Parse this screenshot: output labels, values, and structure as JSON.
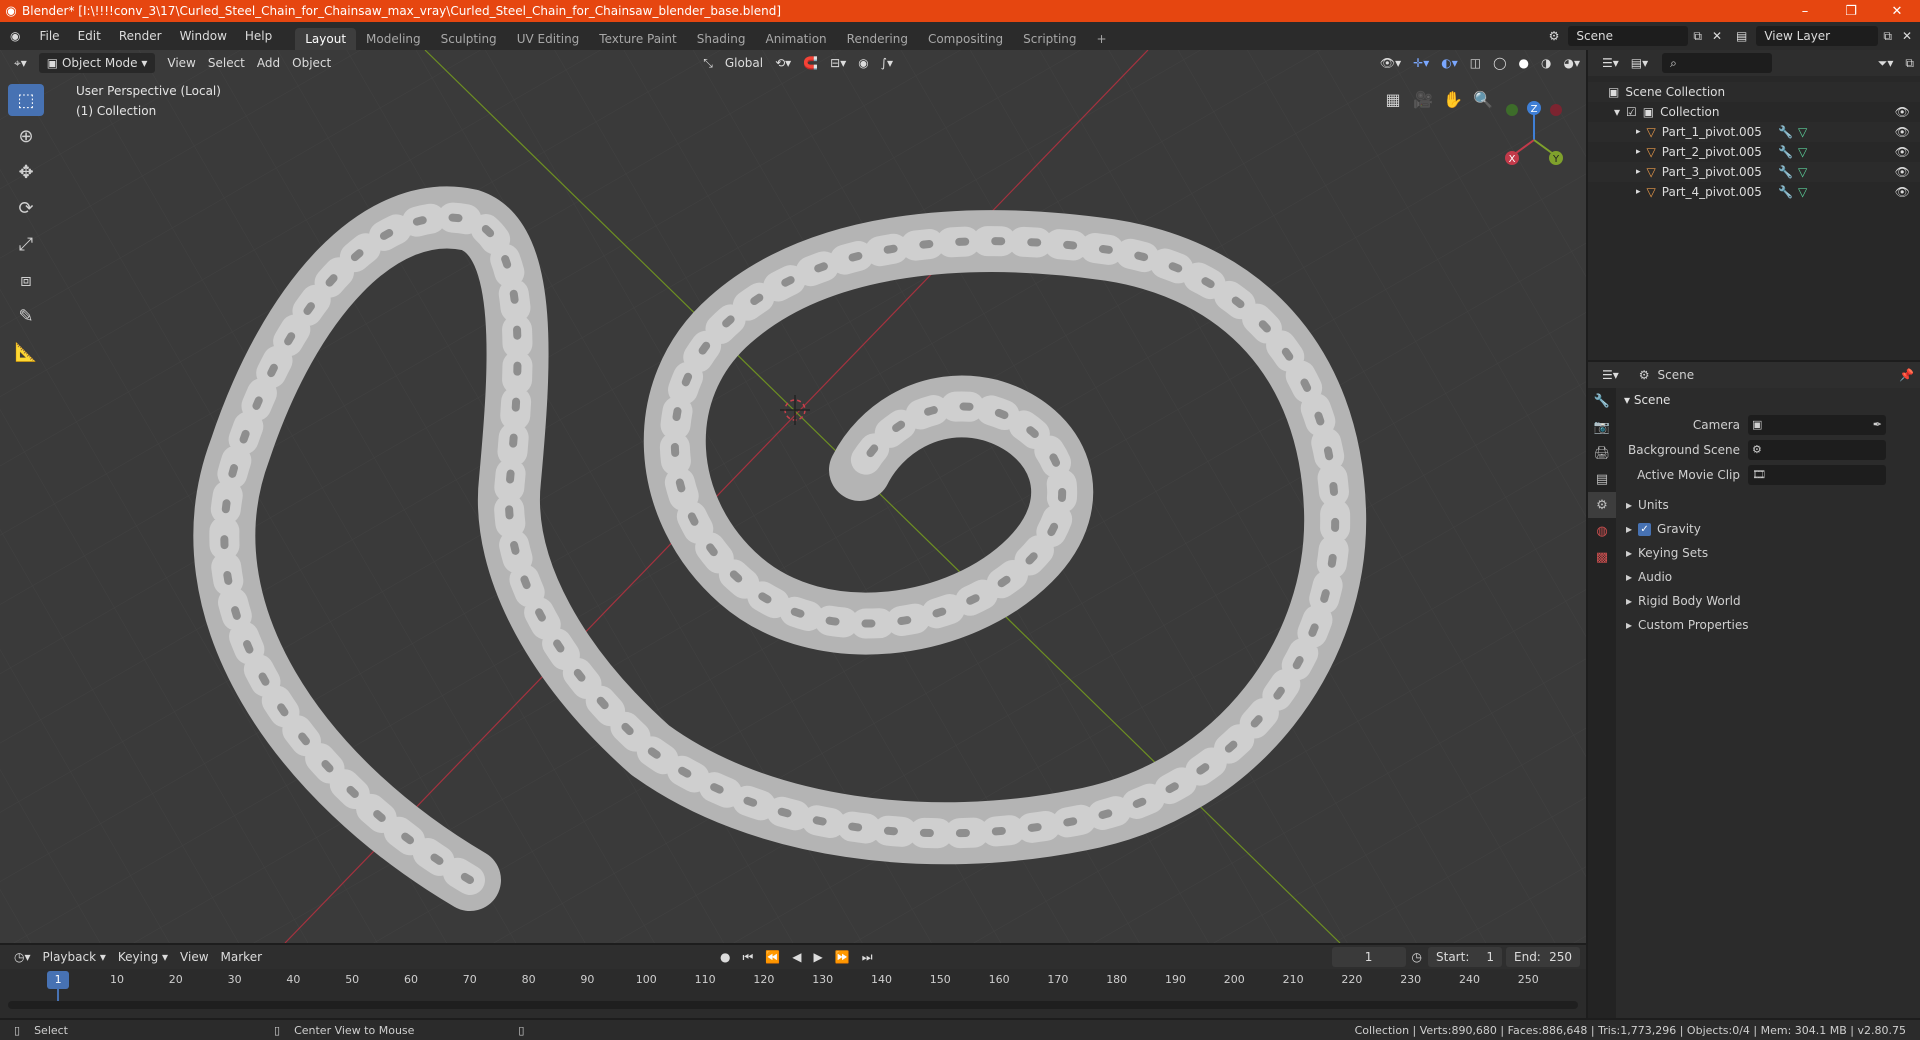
{
  "titlebar": {
    "title": "Blender* [I:\\!!!!conv_3\\17\\Curled_Steel_Chain_for_Chainsaw_max_vray\\Curled_Steel_Chain_for_Chainsaw_blender_base.blend]",
    "minimize": "–",
    "restore": "❐",
    "close": "✕"
  },
  "menu": {
    "items": [
      "File",
      "Edit",
      "Render",
      "Window",
      "Help"
    ],
    "workspaces": [
      "Layout",
      "Modeling",
      "Sculpting",
      "UV Editing",
      "Texture Paint",
      "Shading",
      "Animation",
      "Rendering",
      "Compositing",
      "Scripting"
    ],
    "active_workspace": "Layout",
    "add_workspace": "+",
    "scene_name": "Scene",
    "view_layer": "View Layer"
  },
  "viewport": {
    "mode": "Object Mode",
    "menus": [
      "View",
      "Select",
      "Add",
      "Object"
    ],
    "orientation": "Global",
    "info_line1": "User Perspective (Local)",
    "info_line2": "(1) Collection",
    "gizmo": {
      "x": "X",
      "y": "Y",
      "z": "Z"
    }
  },
  "outliner": {
    "root": "Scene Collection",
    "collection": "Collection",
    "objects": [
      "Part_1_pivot.005",
      "Part_2_pivot.005",
      "Part_3_pivot.005",
      "Part_4_pivot.005"
    ]
  },
  "properties": {
    "context": "Scene",
    "panel": "Scene",
    "fields": [
      {
        "label": "Camera",
        "value": ""
      },
      {
        "label": "Background Scene",
        "value": ""
      },
      {
        "label": "Active Movie Clip",
        "value": ""
      }
    ],
    "subpanels": [
      "Units",
      "Gravity",
      "Keying Sets",
      "Audio",
      "Rigid Body World",
      "Custom Properties"
    ],
    "gravity_checked": true
  },
  "timeline": {
    "menus": [
      "Playback",
      "Keying",
      "View",
      "Marker"
    ],
    "current_frame": "1",
    "start_label": "Start:",
    "start": "1",
    "end_label": "End:",
    "end": "250",
    "ticks": [
      "1",
      "10",
      "20",
      "30",
      "40",
      "50",
      "60",
      "70",
      "80",
      "90",
      "100",
      "110",
      "120",
      "130",
      "140",
      "150",
      "160",
      "170",
      "180",
      "190",
      "200",
      "210",
      "220",
      "230",
      "240",
      "250"
    ]
  },
  "statusbar": {
    "select": "Select",
    "center_view": "Center View to Mouse",
    "stats": "Collection | Verts:890,680 | Faces:886,648 | Tris:1,773,296 | Objects:0/4 | Mem: 304.1 MB | v2.80.75"
  },
  "colors": {
    "accent": "#4772b3",
    "titlebar": "#e64610",
    "axis_x": "#c23a4a",
    "axis_y": "#7fa12c",
    "axis_z": "#3f7fd6"
  }
}
